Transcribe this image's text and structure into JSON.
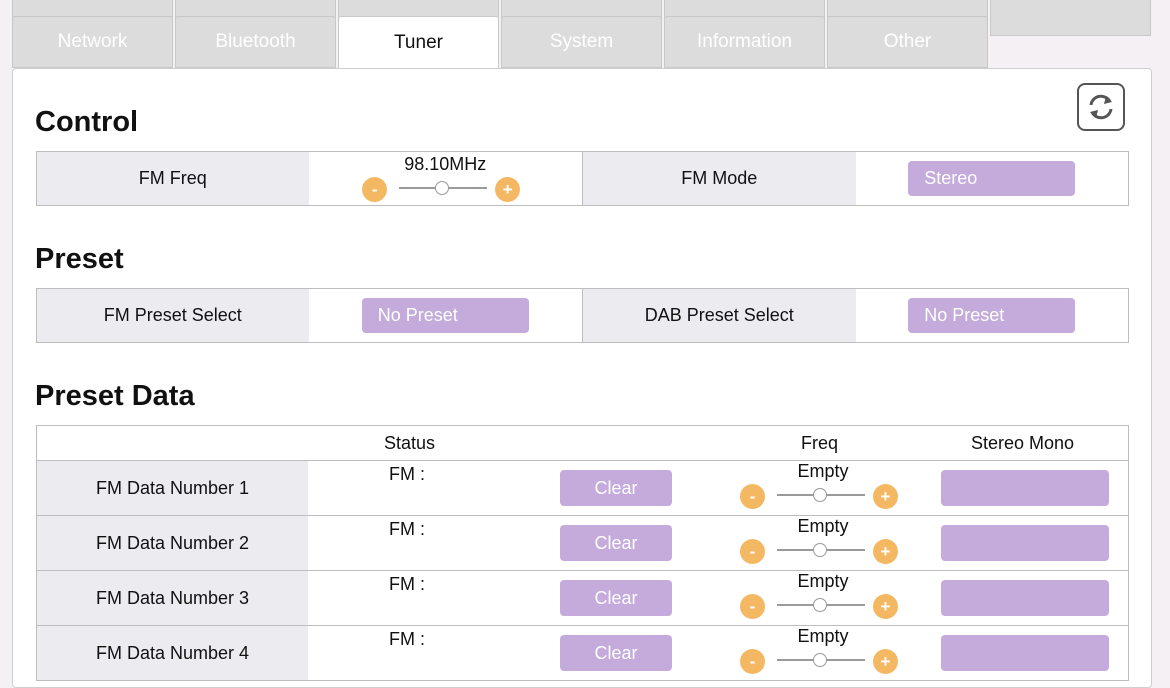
{
  "tabs": {
    "top": [
      "",
      "",
      "",
      "",
      "",
      "",
      ""
    ],
    "main": [
      "Network",
      "Bluetooth",
      "Tuner",
      "System",
      "Information",
      "Other"
    ],
    "active": "Tuner"
  },
  "control": {
    "title": "Control",
    "fm_freq_label": "FM Freq",
    "fm_freq_value": "98.10MHz",
    "fm_mode_label": "FM Mode",
    "fm_mode_value": "Stereo"
  },
  "preset": {
    "title": "Preset",
    "fm_label": "FM Preset Select",
    "fm_value": "No Preset",
    "dab_label": "DAB Preset Select",
    "dab_value": "No Preset"
  },
  "preset_data": {
    "title": "Preset Data",
    "headers": {
      "status": "Status",
      "freq": "Freq",
      "stereo_mono": "Stereo Mono"
    },
    "rows": [
      {
        "name": "FM Data Number 1",
        "status": "FM :",
        "clear": "Clear",
        "freq": "Empty",
        "stereo_mono": ""
      },
      {
        "name": "FM Data Number 2",
        "status": "FM :",
        "clear": "Clear",
        "freq": "Empty",
        "stereo_mono": ""
      },
      {
        "name": "FM Data Number 3",
        "status": "FM :",
        "clear": "Clear",
        "freq": "Empty",
        "stereo_mono": ""
      },
      {
        "name": "FM Data Number 4",
        "status": "FM :",
        "clear": "Clear",
        "freq": "Empty",
        "stereo_mono": ""
      }
    ]
  },
  "icons": {
    "refresh": "refresh-icon",
    "minus": "minus",
    "plus": "plus"
  },
  "colors": {
    "accent": "#c4abdc",
    "stepper": "#f5b862"
  },
  "stepper": {
    "minus": "-",
    "plus": "+"
  }
}
